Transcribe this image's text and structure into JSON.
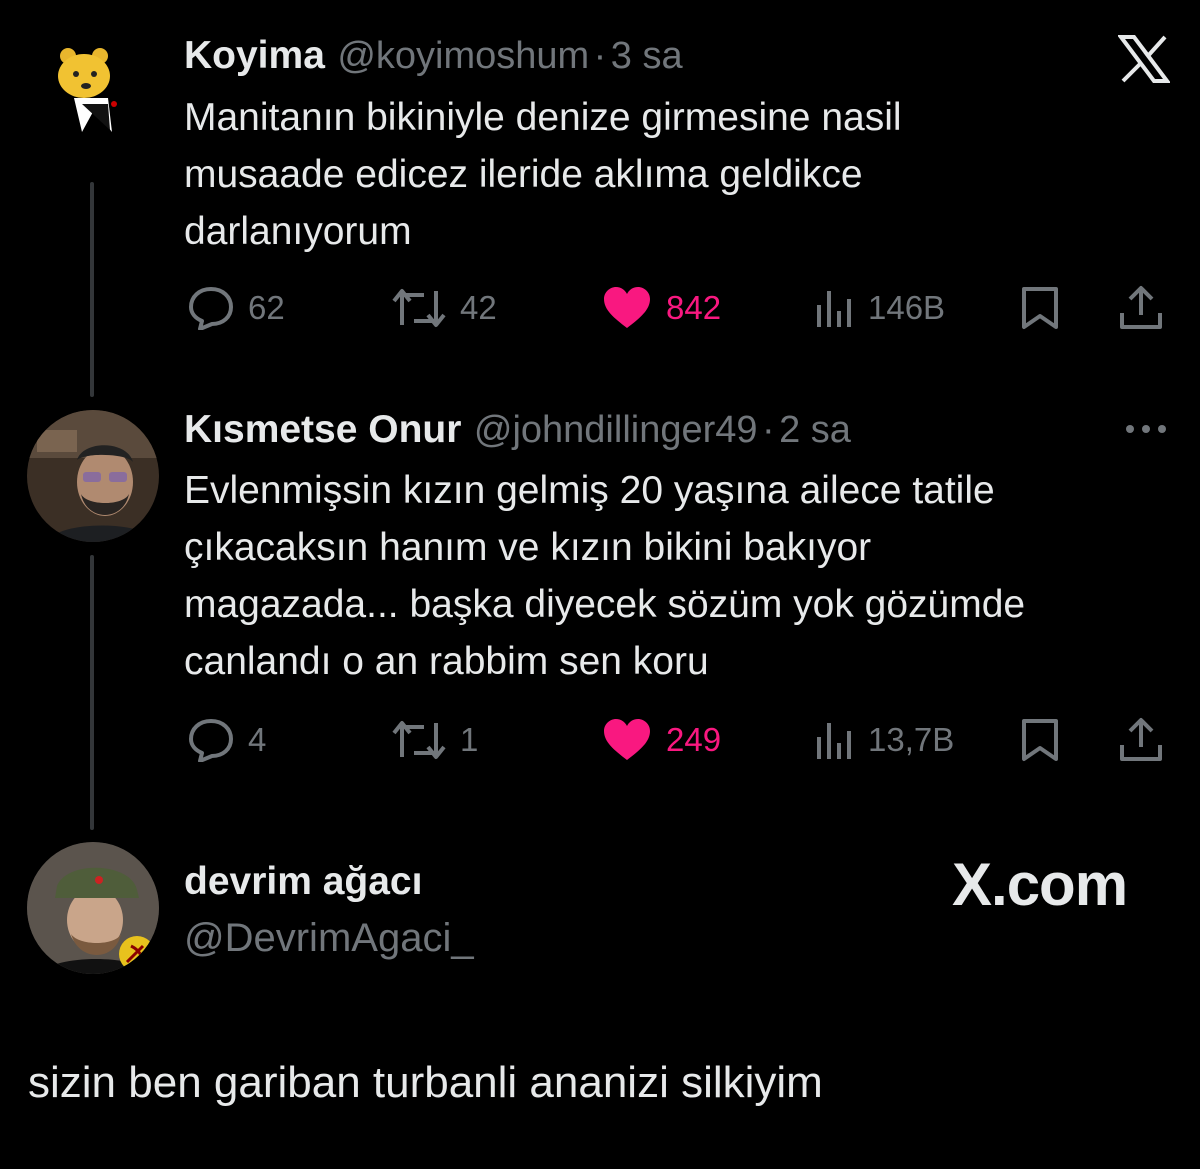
{
  "tweets": [
    {
      "name": "Koyima",
      "handle": "@koyimoshum",
      "separator": "·",
      "time": "3 sa",
      "text": "Manitanın bikiniyle denize girmesine nasil\nmusaade edicez ileride aklıma geldikce\ndarlanıyorum",
      "avatar_icon": "pooh-bear-icon",
      "counts": {
        "replies": "62",
        "reposts": "42",
        "likes": "842",
        "views": "146B"
      }
    },
    {
      "name": "Kısmetse Onur",
      "handle": "@johndillinger49",
      "separator": "·",
      "time": "2 sa",
      "text": "Evlenmişsin kızın gelmiş 20 yaşına ailece tatile\nçıkacaksın hanım ve kızın bikini bakıyor\nmagazada... başka diyecek sözüm yok gözümde\ncanlandı o an rabbim sen koru",
      "avatar_icon": "user-photo-icon",
      "counts": {
        "replies": "4",
        "reposts": "1",
        "likes": "249",
        "views": "13,7B"
      }
    }
  ],
  "quoter": {
    "name": "devrim ağacı",
    "handle": "@DevrimAgaci_",
    "watermark": "X.com",
    "avatar_icon": "user-photo-icon"
  },
  "caption": "sizin ben gariban turbanli ananizi silkiyim",
  "icons": {
    "logo": "x-logo-icon",
    "more": "more-dots-icon",
    "reply": "reply-icon",
    "repost": "repost-icon",
    "like": "heart-icon",
    "views": "views-icon",
    "bookmark": "bookmark-icon",
    "share": "share-icon"
  },
  "colors": {
    "background": "#000000",
    "text": "#e7e9ea",
    "muted": "#71767b",
    "like": "#f91880"
  }
}
